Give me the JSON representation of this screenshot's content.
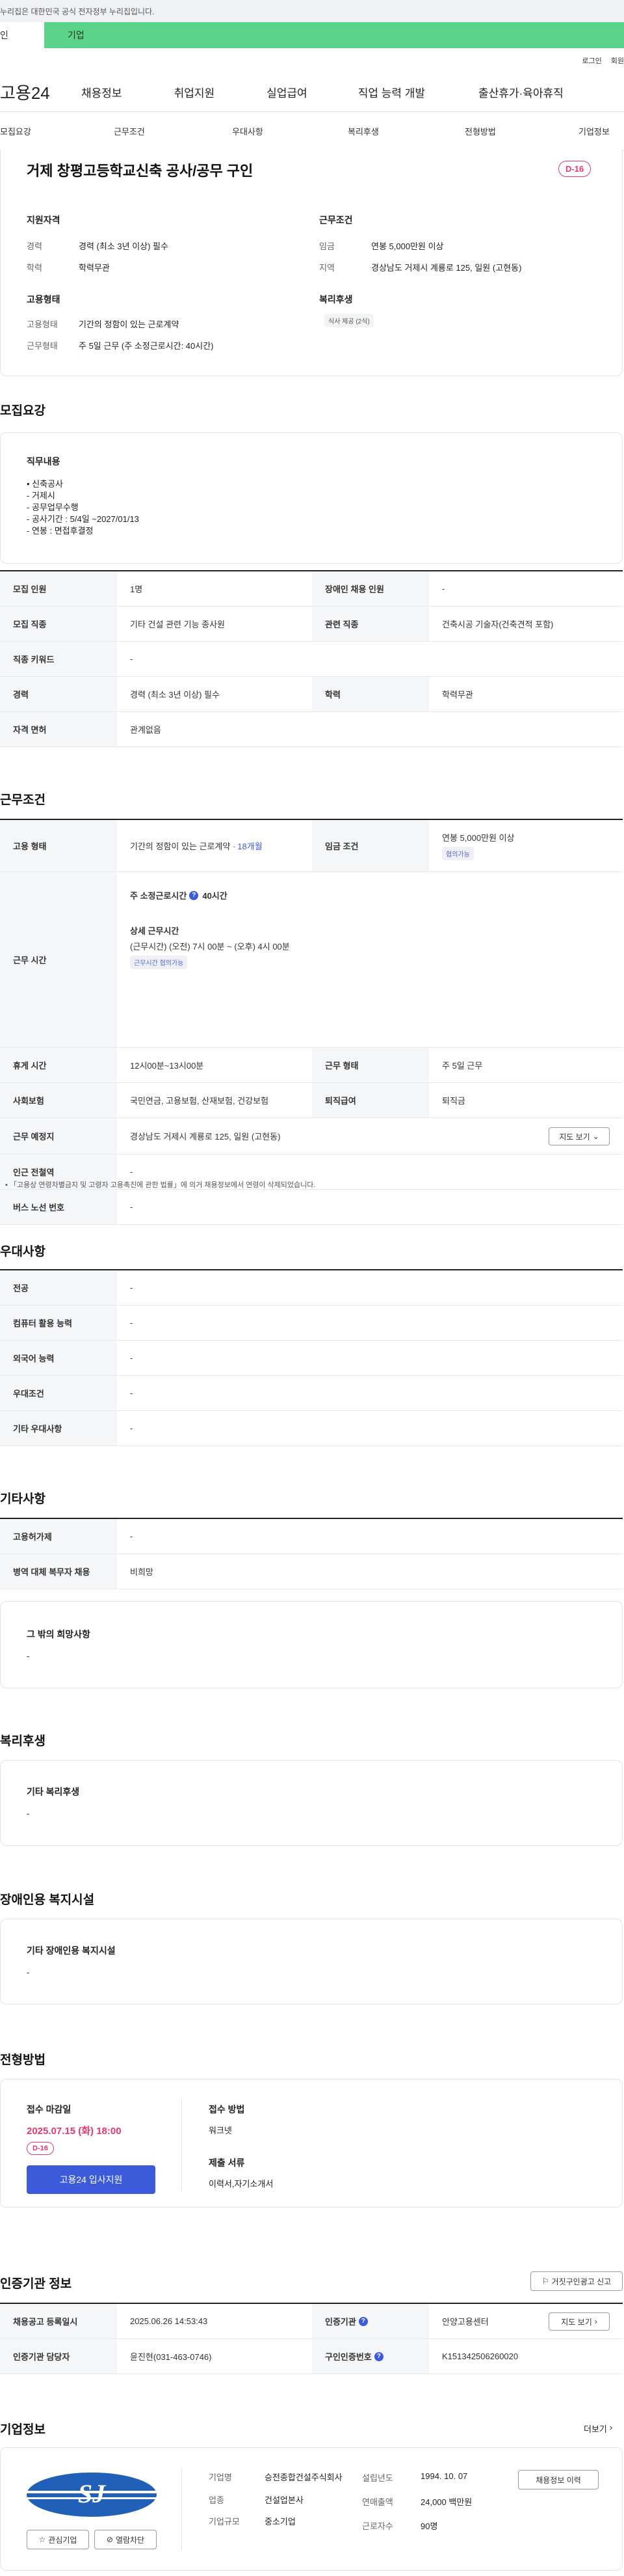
{
  "notice": "누리집은 대한민국 공식 전자정부 누리집입니다.",
  "user_tabs": [
    "인",
    "기업"
  ],
  "util": [
    "로그인",
    "회원"
  ],
  "logo": "고용24",
  "gnb": [
    "채용정보",
    "취업지원",
    "실업급여",
    "직업 능력 개발",
    "출산휴가·육아휴직"
  ],
  "subnav": [
    "모집요강",
    "근무조건",
    "우대사항",
    "복리후생",
    "전형방법",
    "기업정보"
  ],
  "job": {
    "title": "거제 창평고등학교신축 공사/공무 구인",
    "dday": "D-16",
    "qual_h": "지원자격",
    "qual": [
      {
        "k": "경력",
        "v": "경력 (최소 3년 이상) 필수"
      },
      {
        "k": "학력",
        "v": "학력무관"
      }
    ],
    "emp_h": "고용형태",
    "emp": [
      {
        "k": "고용형태",
        "v": "기간의 정함이 있는 근로계약"
      },
      {
        "k": "근무형태",
        "v": "주 5일 근무 (주 소정근로시간: 40시간)"
      }
    ],
    "cond_h": "근무조건",
    "cond": [
      {
        "k": "임금",
        "v": "연봉 5,000만원 이상"
      },
      {
        "k": "지역",
        "v": "경상남도 거제시 계룡로 125, 일원 (고현동)"
      }
    ],
    "welfare_h": "복리후생",
    "welfare_tag": "식사 제공 (2식)"
  },
  "recruit": {
    "h": "모집요강",
    "duty_h": "직무내용",
    "duty": [
      "• 신축공사",
      "- 거제시",
      "- 공무업무수행",
      "- 공사기간 : 5/4일 ~2027/01/13",
      "- 연봉 : 면접후결정"
    ],
    "rows": [
      [
        {
          "t": "th",
          "v": "모집 인원"
        },
        {
          "t": "td",
          "v": "1명"
        },
        {
          "t": "th",
          "v": "장애인 채용 인원"
        },
        {
          "t": "td",
          "v": "-"
        }
      ],
      [
        {
          "t": "th",
          "v": "모집 직종"
        },
        {
          "t": "td",
          "v": "기타 건설 관련 기능 종사원"
        },
        {
          "t": "th",
          "v": "관련 직종"
        },
        {
          "t": "td",
          "v": "건축시공 기술자(건축견적 포함)"
        }
      ],
      [
        {
          "t": "th",
          "v": "직종 키워드"
        },
        {
          "t": "td",
          "v": "-"
        }
      ],
      [
        {
          "t": "th",
          "v": "경력"
        },
        {
          "t": "td",
          "v": "경력 (최소 3년 이상) 필수"
        },
        {
          "t": "th",
          "v": "학력"
        },
        {
          "t": "td",
          "v": "학력무관"
        }
      ],
      [
        {
          "t": "th",
          "v": "자격 면허"
        },
        {
          "t": "td",
          "v": "관계없음"
        }
      ]
    ]
  },
  "work": {
    "h": "근무조건",
    "emp_type_k": "고용 형태",
    "emp_type_v": "기간의 정함이 있는 근로계약 · ",
    "emp_type_link": "18개월",
    "wage_k": "임금 조건",
    "wage_v": "연봉 5,000만원 이상",
    "wage_tag": "협의가능",
    "hours_k": "근무 시간",
    "hours_title": "주 소정근로시간",
    "hours_value": "40시간",
    "hours_detail_h": "상세 근무시간",
    "hours_detail": "(근무시간) (오전) 7시 00분 ~ (오후) 4시 00분",
    "hours_tag": "근무시간 협의가능",
    "rows": [
      {
        "k1": "휴게 시간",
        "v1": "12시00분~13시00분",
        "k2": "근무 형태",
        "v2": "주 5일 근무"
      },
      {
        "k1": "사회보험",
        "v1": "국민연금, 고용보험, 산재보험, 건강보험",
        "k2": "퇴직급여",
        "v2": "퇴직금"
      }
    ],
    "place_k": "근무 예정지",
    "place_v": "경상남도 거제시 계룡로 125, 일원 (고현동)",
    "map_btn": "지도 보기",
    "station_k": "인근 전철역",
    "station_v": "-",
    "bus_k": "버스 노선 번호",
    "bus_v": "-",
    "footnote": "「고용상 연령차별금지 및 고령자 고용촉진에 관한 법률」에 의거 채용정보에서 연령이 삭제되었습니다."
  },
  "pref": {
    "h": "우대사항",
    "rows": [
      {
        "k": "전공",
        "v": "-"
      },
      {
        "k": "컴퓨터 활용 능력",
        "v": "-"
      },
      {
        "k": "외국어 능력",
        "v": "-"
      },
      {
        "k": "우대조건",
        "v": "-"
      },
      {
        "k": "기타 우대사항",
        "v": "-"
      }
    ]
  },
  "etc": {
    "h": "기타사항",
    "rows": [
      {
        "k": "고용허가제",
        "v": "-"
      },
      {
        "k": "병역 대체 복무자 채용",
        "v": "비희망"
      }
    ],
    "other_h": "그 밖의 희망사항",
    "other_v": "-"
  },
  "benefit": {
    "h": "복리후생",
    "box_h": "기타 복리후생",
    "box_v": "-"
  },
  "disabled": {
    "h": "장애인용 복지시설",
    "box_h": "기타 장애인용 복지시설",
    "box_v": "-"
  },
  "process": {
    "h": "전형방법",
    "deadline_h": "접수 마감일",
    "deadline_v": "2025.07.15 (화) 18:00",
    "dday": "D-16",
    "apply_btn": "고용24 입사지원",
    "method_h": "접수 방법",
    "method_v": "워크넷",
    "docs_h": "제출 서류",
    "docs_v": "이력서,자기소개서"
  },
  "cert": {
    "h": "인증기관 정보",
    "report_btn": "거짓구인광고 신고",
    "rows": [
      {
        "k1": "채용공고 등록일시",
        "v1": "2025.06.26 14:53:43",
        "k2": "인증기관",
        "v2": "안양고용센터",
        "btn": "지도 보기"
      },
      {
        "k1": "인증기관 담당자",
        "v1": "윤진현(031-463-0746)",
        "k2": "구인인증번호",
        "v2": "K151342506260020"
      }
    ]
  },
  "company": {
    "h": "기업정보",
    "more": "더보기",
    "logo_text": "SJ",
    "fav_btn": "관심기업",
    "block_btn": "열람차단",
    "info": [
      {
        "k": "기업명",
        "v": "승전종합건설주식회사"
      },
      {
        "k": "업종",
        "v": "건설업본사"
      },
      {
        "k": "기업규모",
        "v": "중소기업"
      }
    ],
    "info2": [
      {
        "k": "설립년도",
        "v": "1994. 10. 07"
      },
      {
        "k": "연매출액",
        "v": "24,000 백만원"
      },
      {
        "k": "근로자수",
        "v": "90명"
      }
    ],
    "history_btn": "채용정보 이력"
  },
  "colors": {
    "accent": "#3b5bdb",
    "green": "#5bd38a",
    "dday": "#e8386d",
    "apply": "#3b5bdb"
  }
}
